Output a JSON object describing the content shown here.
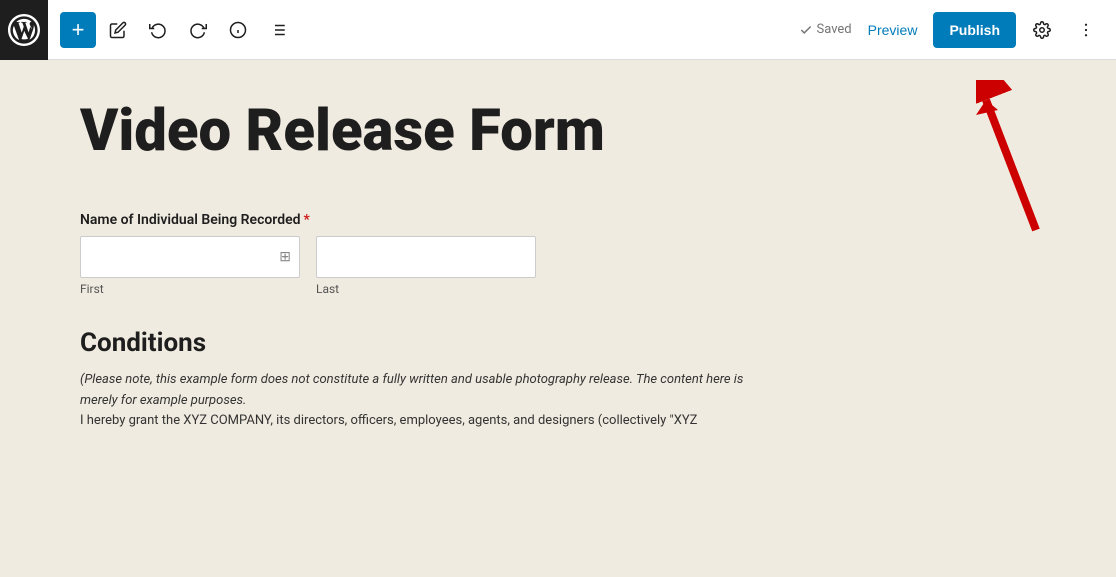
{
  "toolbar": {
    "add_label": "+",
    "saved_label": "Saved",
    "preview_label": "Preview",
    "publish_label": "Publish"
  },
  "page": {
    "title": "Video Release Form",
    "form": {
      "name_field_label": "Name of Individual Being Recorded",
      "first_sublabel": "First",
      "last_sublabel": "Last"
    },
    "conditions": {
      "title": "Conditions",
      "text_italic": "(Please note, this example form does not constitute a fully written and usable photography release. The content here is merely for example purposes.",
      "text_normal": "I hereby grant the XYZ COMPANY, its directors, officers, employees, agents, and designers (collectively \"XYZ"
    }
  }
}
